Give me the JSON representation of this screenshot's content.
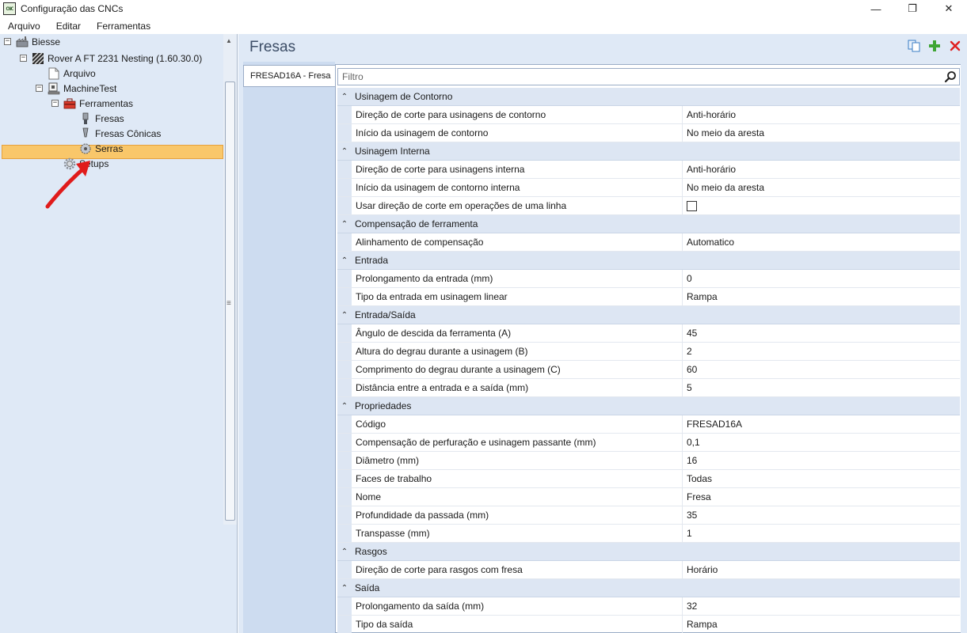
{
  "window": {
    "title": "Configuração das CNCs",
    "app_icon_text": "CNC",
    "minimize": "—",
    "maximize": "❐",
    "close": "✕"
  },
  "menu": [
    "Arquivo",
    "Editar",
    "Ferramentas"
  ],
  "tree": {
    "items": [
      {
        "label": "Biesse",
        "expander": "−",
        "icon": "factory-icon"
      },
      {
        "label": "Rover A FT 2231 Nesting (1.60.30.0)",
        "expander": "−",
        "icon": "machine-icon"
      },
      {
        "label": "Arquivo",
        "icon": "document-icon"
      },
      {
        "label": "MachineTest",
        "expander": "−",
        "icon": "machine-test-icon"
      },
      {
        "label": "Ferramentas",
        "expander": "−",
        "icon": "toolbox-icon"
      },
      {
        "label": "Fresas",
        "icon": "router-bit-icon",
        "selected": true
      },
      {
        "label": "Fresas Cônicas",
        "icon": "conical-bit-icon"
      },
      {
        "label": "Serras",
        "icon": "saw-icon"
      },
      {
        "label": "Setups",
        "icon": "gear-icon"
      }
    ]
  },
  "header": {
    "title": "Fresas",
    "icons": [
      "copy-icon",
      "add-icon",
      "delete-icon"
    ]
  },
  "tab": {
    "label": "FRESAD16A - Fresa"
  },
  "filter": {
    "placeholder": "Filtro"
  },
  "grid": [
    {
      "category": "Usinagem de Contorno",
      "rows": [
        {
          "name": "Direção de corte para usinagens de contorno",
          "value": "Anti-horário"
        },
        {
          "name": "Início da usinagem de contorno",
          "value": "No meio da aresta"
        }
      ]
    },
    {
      "category": "Usinagem Interna",
      "rows": [
        {
          "name": "Direção de corte para usinagens interna",
          "value": "Anti-horário"
        },
        {
          "name": "Início da usinagem de contorno interna",
          "value": "No meio da aresta"
        },
        {
          "name": "Usar direção de corte em operações de uma linha",
          "value": "",
          "checkbox": true,
          "checked": false
        }
      ]
    },
    {
      "category": "Compensação de ferramenta",
      "rows": [
        {
          "name": "Alinhamento de compensação",
          "value": "Automatico"
        }
      ]
    },
    {
      "category": "Entrada",
      "rows": [
        {
          "name": "Prolongamento da entrada (mm)",
          "value": "0"
        },
        {
          "name": "Tipo da entrada em usinagem linear",
          "value": "Rampa"
        }
      ]
    },
    {
      "category": "Entrada/Saída",
      "rows": [
        {
          "name": "Ângulo de descida da ferramenta (A)",
          "value": "45"
        },
        {
          "name": "Altura do degrau durante a usinagem (B)",
          "value": "2"
        },
        {
          "name": "Comprimento do degrau durante a usinagem (C)",
          "value": "60"
        },
        {
          "name": "Distância entre a entrada e a saída (mm)",
          "value": "5"
        }
      ]
    },
    {
      "category": "Propriedades",
      "rows": [
        {
          "name": "Código",
          "value": "FRESAD16A"
        },
        {
          "name": "Compensação de perfuração e usinagem passante (mm)",
          "value": "0,1"
        },
        {
          "name": "Diâmetro (mm)",
          "value": "16"
        },
        {
          "name": "Faces de trabalho",
          "value": "Todas"
        },
        {
          "name": "Nome",
          "value": "Fresa"
        },
        {
          "name": "Profundidade da passada (mm)",
          "value": "35"
        },
        {
          "name": "Transpasse (mm)",
          "value": "1"
        }
      ]
    },
    {
      "category": "Rasgos",
      "rows": [
        {
          "name": "Direção de corte para rasgos com fresa",
          "value": "Horário"
        }
      ]
    },
    {
      "category": "Saída",
      "rows": [
        {
          "name": "Prolongamento da saída (mm)",
          "value": "32"
        },
        {
          "name": "Tipo da saída",
          "value": "Rampa"
        }
      ]
    }
  ]
}
